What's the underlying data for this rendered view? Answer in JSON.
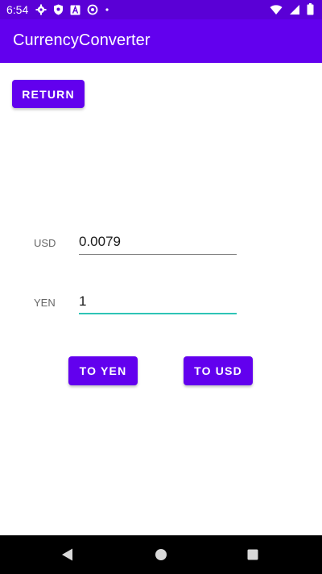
{
  "status_bar": {
    "time": "6:54",
    "left_icons": [
      "gear-icon",
      "shield-icon",
      "text-a-icon",
      "at-icon",
      "dot-icon"
    ],
    "right_icons": [
      "wifi-icon",
      "signal-icon",
      "battery-icon"
    ]
  },
  "app_bar": {
    "title": "CurrencyConverter"
  },
  "buttons": {
    "return_label": "RETURN",
    "to_yen_label": "TO YEN",
    "to_usd_label": "TO USD"
  },
  "fields": {
    "usd_label": "USD",
    "usd_value": "0.0079",
    "yen_label": "YEN",
    "yen_value": "1"
  },
  "nav_bar": {
    "icons": [
      "back-icon",
      "home-icon",
      "recents-icon"
    ]
  },
  "colors": {
    "status_bar": "#5a00d6",
    "primary": "#6200ee",
    "focused_underline": "#2ec4b6",
    "nav_bar": "#000000"
  }
}
